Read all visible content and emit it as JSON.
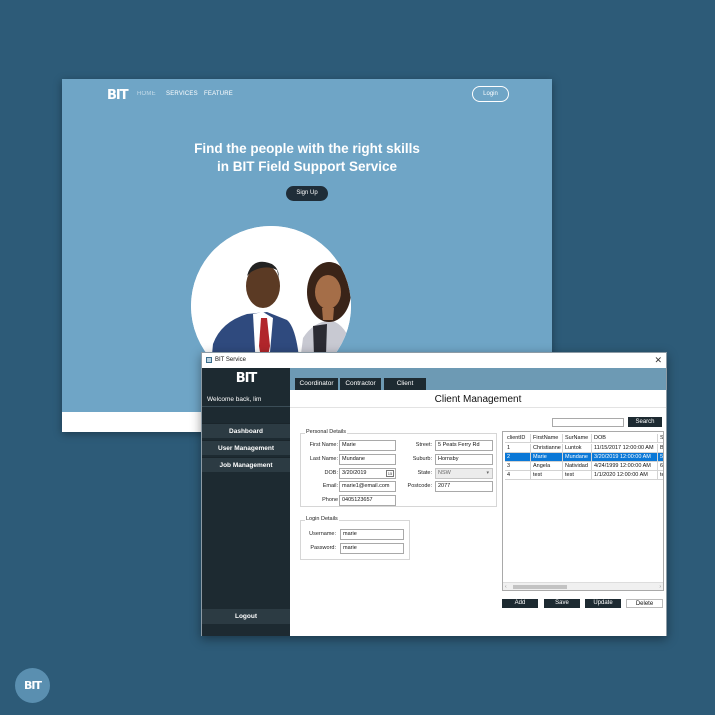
{
  "website": {
    "logo": "BIT",
    "nav": [
      "HOME",
      "SERVICES",
      "FEATURE"
    ],
    "login": "Login",
    "hero_line1": "Find the people with the right skills",
    "hero_line2": "in BIT Field Support Service",
    "signup": "Sign Up"
  },
  "app": {
    "title": "BIT Service",
    "close": "✕",
    "brand": "BIT",
    "welcome": "Welcome back, lim",
    "sidebar": [
      "Dashboard",
      "User Management",
      "Job Management"
    ],
    "logout": "Logout",
    "tabs": [
      "Coordinator",
      "Contractor",
      "Client"
    ],
    "heading": "Client Management",
    "personal_legend": "Personal Details",
    "labels": {
      "first_name": "First Name:",
      "last_name": "Last Name:",
      "dob": "DOB:",
      "email": "Email:",
      "phone": "Phone",
      "street": "Street:",
      "suburb": "Suburb:",
      "state": "State:",
      "postcode": "Postcode:"
    },
    "values": {
      "first_name": "Marie",
      "last_name": "Mundane",
      "dob": "3/20/2019",
      "email": "marie1@email.com",
      "phone": "0405123657",
      "street": "5 Peats Ferry Rd",
      "suburb": "Hornsby",
      "state": "NSW",
      "postcode": "2077"
    },
    "login_legend": "Login Details",
    "login_labels": {
      "username": "Username:",
      "password": "Password:"
    },
    "login_values": {
      "username": "marie",
      "password": "marie"
    },
    "search_button": "Search",
    "grid": {
      "columns": [
        "clientID",
        "FirstName",
        "SurName",
        "DOB",
        "S"
      ],
      "rows": [
        [
          "1",
          "Christianne",
          "Luntok",
          "11/15/2017 12:00:00 AM",
          "B"
        ],
        [
          "2",
          "Marie",
          "Mundane",
          "3/20/2019 12:00:00 AM",
          "5"
        ],
        [
          "3",
          "Angela",
          "Natividad",
          "4/24/1999 12:00:00 AM",
          "6"
        ],
        [
          "4",
          "test",
          "test",
          "1/1/2020 12:00:00 AM",
          "te"
        ]
      ],
      "selected_row": 1
    },
    "buttons": [
      "Add",
      "Save",
      "Update",
      "Delete"
    ]
  },
  "corner_logo": "BIT"
}
